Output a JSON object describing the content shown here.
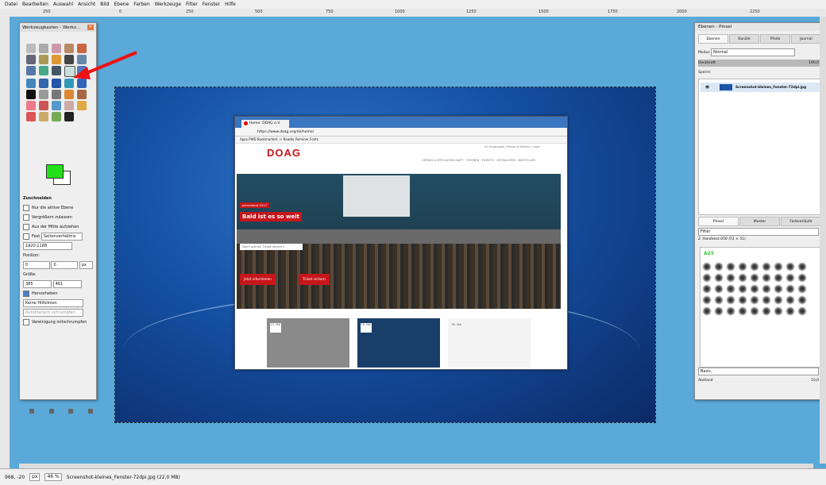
{
  "menu": [
    "Datei",
    "Bearbeiten",
    "Auswahl",
    "Ansicht",
    "Bild",
    "Ebene",
    "Farben",
    "Werkzeuge",
    "Filter",
    "Fenster",
    "Hilfe"
  ],
  "ruler_marks": [
    "250",
    "0",
    "250",
    "500",
    "750",
    "1000",
    "1250",
    "1500",
    "1750",
    "2000",
    "2250"
  ],
  "toolbox": {
    "title": "Werkzeugkasten - Werkz...",
    "tool_name": "Zuschneiden",
    "opt1": "Nur die aktive Ebene",
    "opt2": "Vergrößern zulassen",
    "opt3": "Aus der Mitte aufziehen",
    "fest_label": "Fest",
    "fest_value": "Seitenverhältnis",
    "ratio": "1920:1188",
    "position_label": "Position:",
    "pos_x": "0",
    "pos_y": "0",
    "unit": "px",
    "groesse_label": "Größe:",
    "size_w": "385",
    "size_h": "461",
    "hervorheben": "Hervorheben",
    "hilfslinien": "Keine Hilfslinien",
    "auto_schrumpfen": "Automatisch schrumpfen",
    "vereinigung": "Vereinigung mitschrumpfen",
    "fg_color": "#22e01a"
  },
  "browser": {
    "tab": "Home: DOAG e.V.",
    "url": "https://www.doag.org/de/home/",
    "bookmarks": "Apps   PWD Bookmarklet   -> Reader   Reminer   Fonts",
    "logo": "DOAG",
    "top_links": "All Languages  |  Presse & Medien  |  Login",
    "nav": "VEREIN & MITGLIEDSCHAFT  ·  THEMEN  ·  EVENTS  ·  MITMACHEN  ·  BESTELLEN",
    "hero_tag": "Jahrestand 2017",
    "hero_title": "Bald ist es so weit",
    "hero_input": "Noch schnell Ticket sichern!",
    "btn1": "Jetzt informieren",
    "btn2": "Ticket sichern",
    "cards": [
      {
        "date": "15. Mai"
      },
      {
        "date": "16. Mai"
      },
      {
        "date": "05. Mai"
      }
    ]
  },
  "layers": {
    "title": "Ebenen - Pinsel",
    "tabs": [
      "Ebenen",
      "Kanäle",
      "Pfade",
      "Journal"
    ],
    "modus_label": "Modus",
    "modus_value": "Normal",
    "deckkraft_label": "Deckkraft",
    "deckkraft_value": "100,0",
    "sperre_label": "Sperre:",
    "layer_name": "Screenshot-kleines_Fenster-72dpi.jpg"
  },
  "brushes": {
    "tabs": [
      "Pinsel",
      "Muster",
      "Farbverläufe"
    ],
    "filter": "Filter",
    "current": "2. Hardness 050 (51 × 51)",
    "size_label": "A25",
    "preset": "Basic,",
    "spacing_label": "Abstand",
    "spacing_value": "10,0"
  },
  "status": {
    "coords": "968, -20",
    "unit": "px",
    "zoom": "46 %",
    "file": "Screenshot-kleines_Fenster-72dpi.jpg (22,0 MB)"
  }
}
